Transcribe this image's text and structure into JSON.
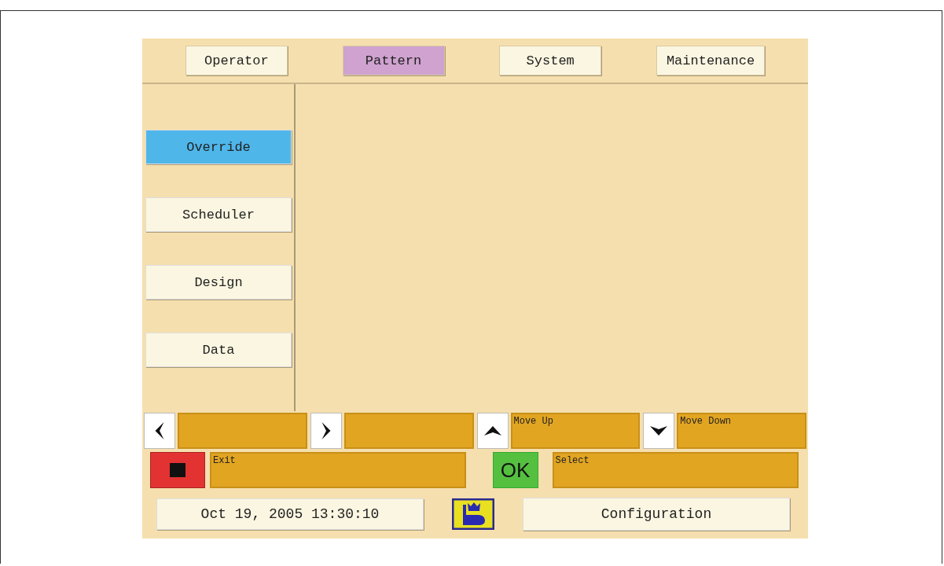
{
  "tabs": [
    {
      "label": "Operator",
      "selected": false
    },
    {
      "label": "Pattern",
      "selected": true
    },
    {
      "label": "System",
      "selected": false
    },
    {
      "label": "Maintenance",
      "selected": false
    }
  ],
  "sidebar": {
    "items": [
      {
        "label": "Override",
        "selected": true
      },
      {
        "label": "Scheduler",
        "selected": false
      },
      {
        "label": "Design",
        "selected": false
      },
      {
        "label": "Data",
        "selected": false
      }
    ]
  },
  "soft_keys": [
    {
      "kind": "left"
    },
    {
      "kind": "right"
    },
    {
      "kind": "up",
      "label": "Move Up"
    },
    {
      "kind": "down",
      "label": "Move Down"
    }
  ],
  "actions": [
    {
      "kind": "stop",
      "label": "Exit"
    },
    {
      "kind": "ok",
      "key": "OK",
      "label": "Select"
    }
  ],
  "status_bar": {
    "datetime": "Oct 19, 2005 13:30:10",
    "config_button": "Configuration"
  }
}
